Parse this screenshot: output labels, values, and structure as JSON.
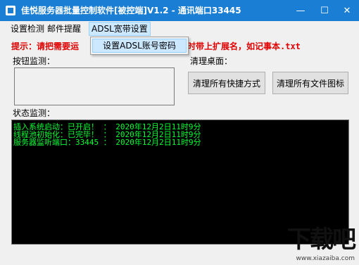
{
  "window": {
    "title": "佳悦服务器批量控制软件[被控端]V1.2 - 通讯端口33445",
    "min": "—",
    "max": "☐",
    "close": "✕"
  },
  "menubar": {
    "items": [
      "设置检测",
      "邮件提醒",
      "ADSL宽带设置"
    ]
  },
  "dropdown": {
    "items": [
      "设置ADSL账号密码"
    ]
  },
  "hint": {
    "prefix": "提示：请把需要运",
    "suffix": "时带上扩展名，如记事本.txt"
  },
  "button_monitor": {
    "label": "按钮监测："
  },
  "desktop_clean": {
    "label": "清理桌面：",
    "btn_shortcuts": "清理所有快捷方式",
    "btn_file_icons": "清理所有文件图标"
  },
  "status_monitor": {
    "label": "状态监测："
  },
  "console": {
    "lines": [
      "插入系统启动：已开启！ ： 2020年12月2日11时9分",
      "线程池初始化：已完毕！ ： 2020年12月2日11时9分",
      "服务器监听端口：33445 ： 2020年12月2日11时9分"
    ]
  },
  "watermark": {
    "logo": "下载吧",
    "url": "www.xiazaiba.com"
  },
  "colors": {
    "titlebar": "#1a7fd4",
    "hint": "#e00000",
    "console_text": "#00ff33",
    "menu_highlight": "#cce8ff"
  }
}
